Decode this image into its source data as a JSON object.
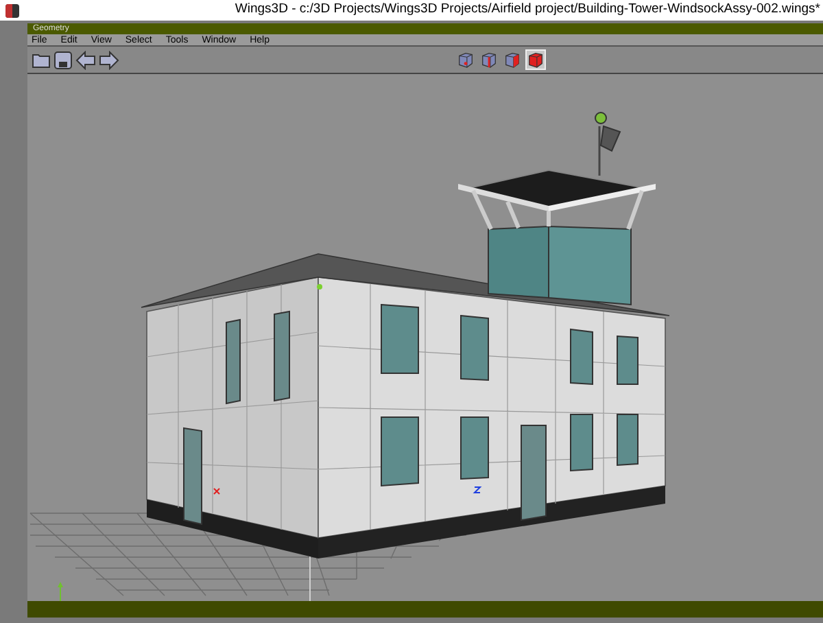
{
  "window": {
    "title": "Wings3D - c:/3D Projects/Wings3D Projects/Airfield project/Building-Tower-WindsockAssy-002.wings*"
  },
  "geometry_window": {
    "title": "Geometry"
  },
  "menu": [
    "File",
    "Edit",
    "View",
    "Select",
    "Tools",
    "Window",
    "Help"
  ],
  "toolbar": [
    {
      "kind": "open"
    },
    {
      "kind": "save"
    },
    {
      "kind": "undo"
    },
    {
      "kind": "redo"
    }
  ],
  "selection_modes": [
    {
      "kind": "vertex",
      "selected": false
    },
    {
      "kind": "edge",
      "selected": false
    },
    {
      "kind": "face",
      "selected": false
    },
    {
      "kind": "body",
      "selected": true
    }
  ]
}
